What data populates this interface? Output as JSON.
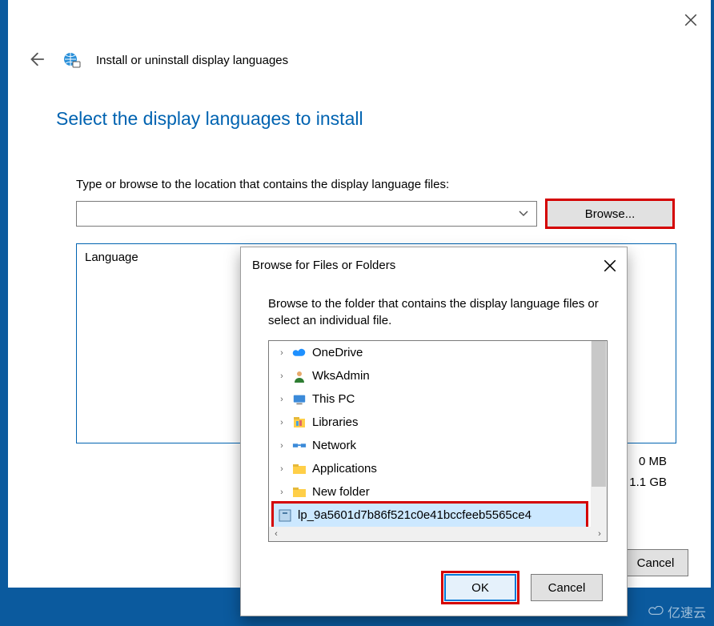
{
  "wizard": {
    "title": "Install or uninstall display languages",
    "heading": "Select the display languages to install",
    "instruction": "Type or browse to the location that contains the display language files:",
    "path_value": "",
    "browse_label": "Browse...",
    "lang_column": "Language",
    "size_required": "0 MB",
    "size_available": "1.1 GB",
    "cancel_label": "Cancel"
  },
  "dialog": {
    "title": "Browse for Files or Folders",
    "instruction": "Browse to the folder that contains the display language files or select an individual file.",
    "ok_label": "OK",
    "cancel_label": "Cancel",
    "tree": [
      {
        "label": "OneDrive",
        "icon": "cloud",
        "expandable": true
      },
      {
        "label": "WksAdmin",
        "icon": "user",
        "expandable": true
      },
      {
        "label": "This PC",
        "icon": "pc",
        "expandable": true
      },
      {
        "label": "Libraries",
        "icon": "lib",
        "expandable": true
      },
      {
        "label": "Network",
        "icon": "net",
        "expandable": true
      },
      {
        "label": "Applications",
        "icon": "folder",
        "expandable": true
      },
      {
        "label": "New folder",
        "icon": "folder",
        "expandable": true
      },
      {
        "label": "lp_9a5601d7b86f521c0e41bccfeeb5565ce4",
        "icon": "cab",
        "expandable": false,
        "selected": true
      }
    ]
  },
  "watermark": "亿速云"
}
